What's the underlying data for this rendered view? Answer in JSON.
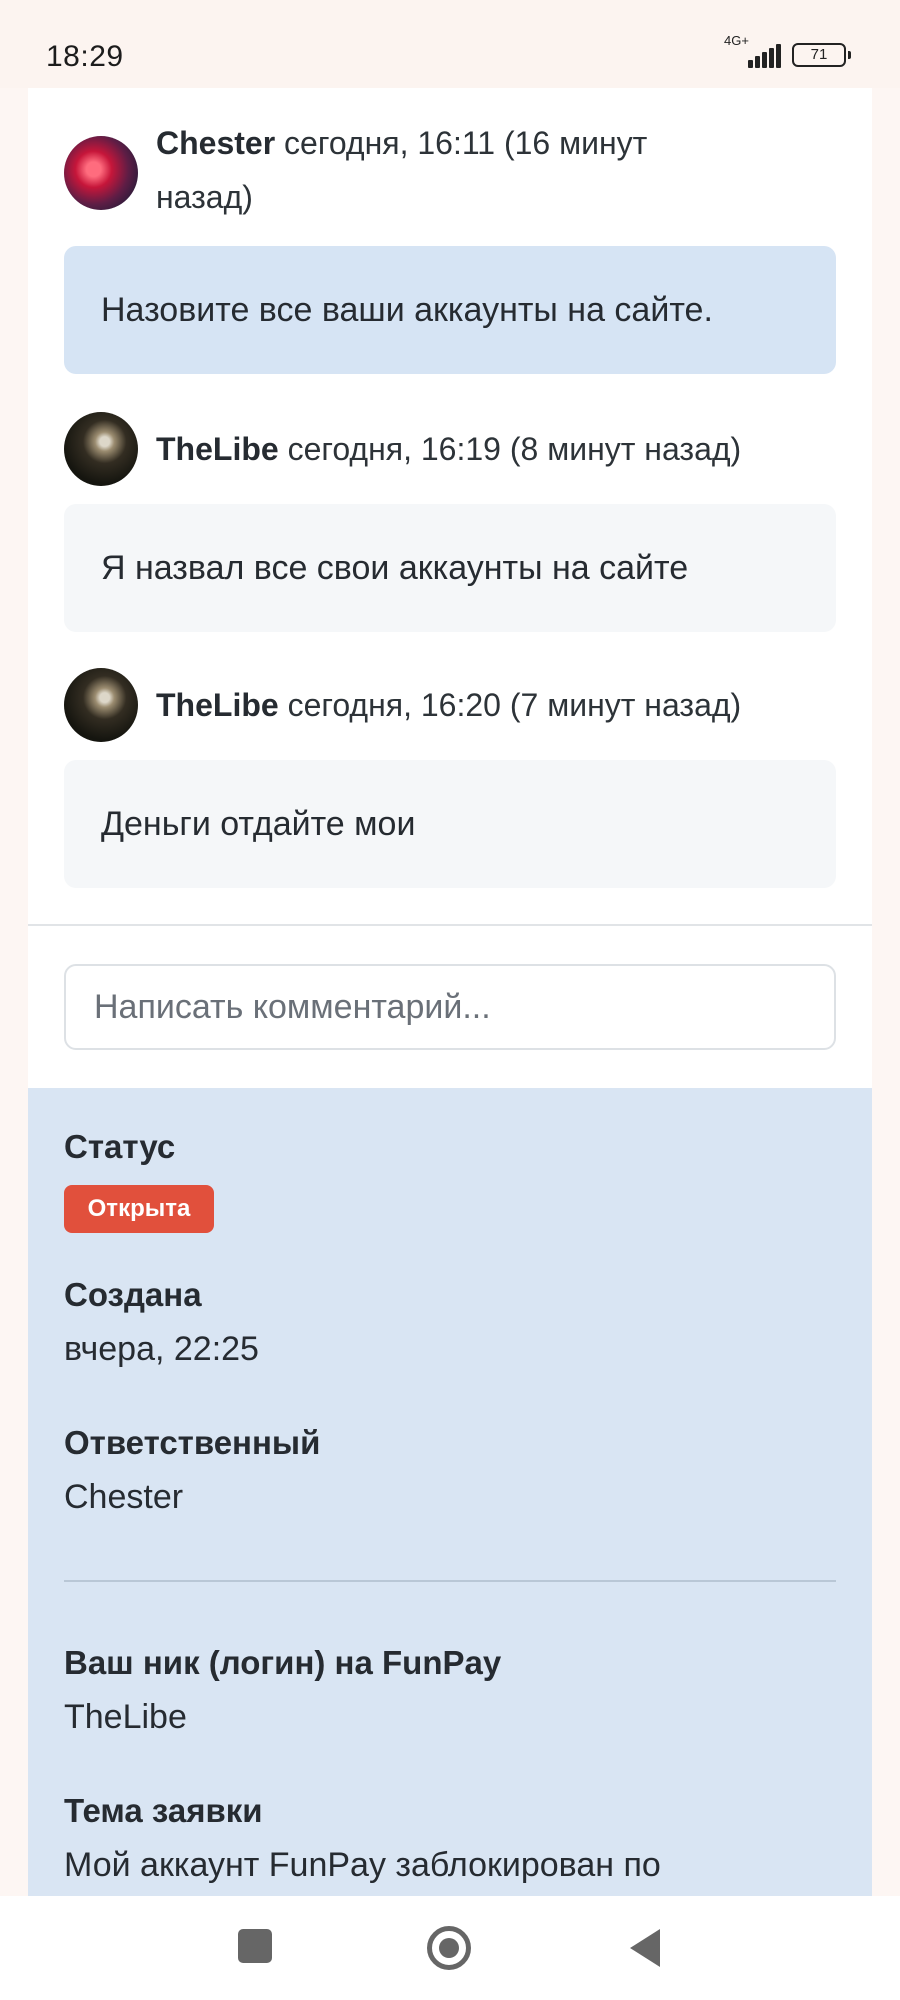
{
  "status_bar": {
    "time": "18:29",
    "network": "4G+",
    "battery": "71"
  },
  "messages": [
    {
      "author": "Chester",
      "meta": " сегодня, 16:11 (16 минут",
      "meta_line2": "назад)",
      "avatar": "chester-avatar",
      "text": "Назовите все ваши аккаунты на сайте."
    },
    {
      "author": "TheLibe",
      "meta": " сегодня, 16:19 (8 минут назад)",
      "avatar": "thelibe-avatar",
      "text": "Я назвал все свои аккаунты на сайте"
    },
    {
      "author": "TheLibe",
      "meta": " сегодня, 16:20 (7 минут назад)",
      "avatar": "thelibe-avatar",
      "text": "Деньги отдайте мои"
    }
  ],
  "comment": {
    "placeholder": "Написать комментарий..."
  },
  "ticket": {
    "status_label": "Статус",
    "status_value": "Открыта",
    "status_color": "#e1503c",
    "created_label": "Создана",
    "created_value": "вчера, 22:25",
    "assignee_label": "Ответственный",
    "assignee_value": "Chester",
    "login_label": "Ваш ник (логин) на FunPay",
    "login_value": "TheLibe",
    "subject_label": "Тема заявки",
    "subject_value": "Мой аккаунт FunPay заблокирован по"
  },
  "nav": {
    "recent": "square-icon",
    "home": "circle-icon",
    "back": "triangle-back-icon"
  },
  "colors": {
    "staff_bubble": "#d6e4f4",
    "user_bubble": "#f5f7f9",
    "info_panel": "#d9e5f3"
  }
}
